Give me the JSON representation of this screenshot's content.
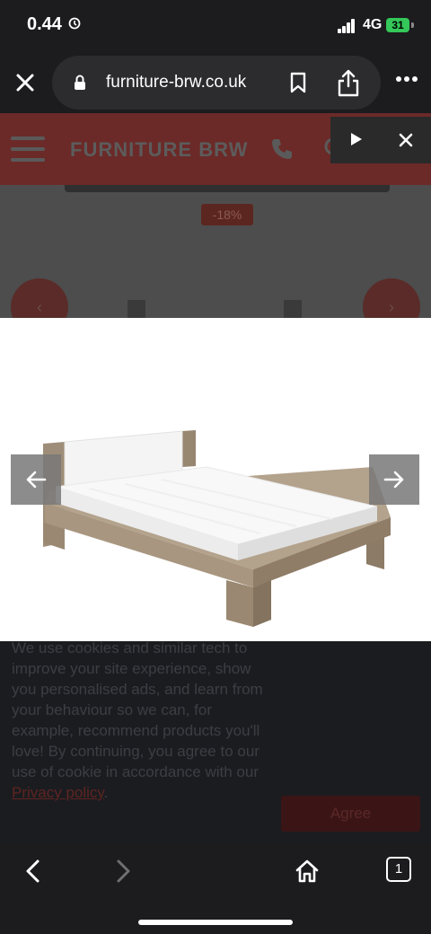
{
  "status_bar": {
    "time": "0.44",
    "network": "4G",
    "battery": "31"
  },
  "browser": {
    "url": "furniture-brw.co.uk"
  },
  "site": {
    "logo": "FURNITURE BRW",
    "discount_badge": "-18%"
  },
  "image_viewer": {
    "icons": [
      "arrow-left-icon",
      "arrow-right-icon"
    ]
  },
  "cookie_banner": {
    "text": "We use cookies and similar tech to improve your site experience, show you personalised ads, and learn from your behaviour so we can, for example, recommend products you'll love! By continuing, you agree to our use of cookie in accordance with our ",
    "link_text": "Privacy policy",
    "suffix": ".",
    "agree_label": "Agree"
  },
  "bottom_bar": {
    "tab_count": "1"
  },
  "colors": {
    "brand_red": "#6b2a28",
    "battery_green": "#34c759"
  }
}
